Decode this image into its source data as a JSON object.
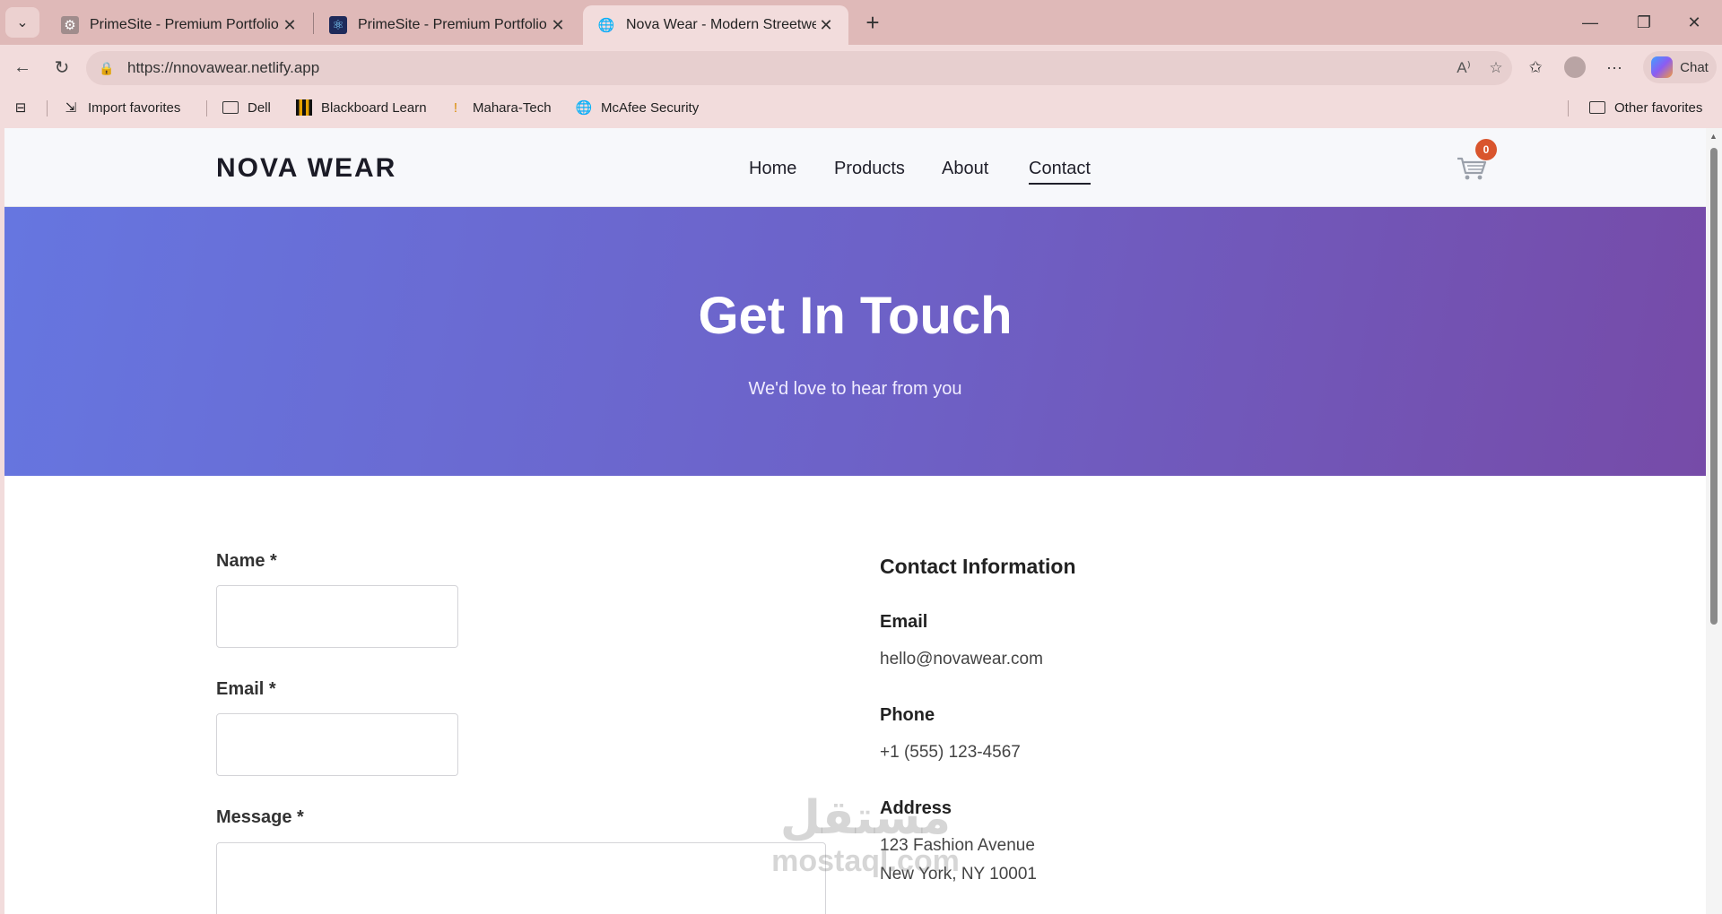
{
  "browser": {
    "tabs": [
      {
        "title": "PrimeSite - Premium Portfolio",
        "icon": "gear-icon"
      },
      {
        "title": "PrimeSite - Premium Portfolio",
        "icon": "react-icon"
      },
      {
        "title": "Nova Wear - Modern Streetwear F",
        "icon": "globe-icon",
        "active": true
      }
    ],
    "url": "https://nnovawear.netlify.app",
    "chat_label": "Chat",
    "bookmarks": [
      {
        "label": "Import favorites",
        "icon": "import-icon"
      },
      {
        "label": "Dell",
        "icon": "folder-icon"
      },
      {
        "label": "Blackboard Learn",
        "icon": "blackboard-icon"
      },
      {
        "label": "Mahara-Tech",
        "icon": "torch-icon"
      },
      {
        "label": "McAfee Security",
        "icon": "globe-icon"
      }
    ],
    "other_favorites": "Other favorites"
  },
  "site": {
    "logo": "NOVA WEAR",
    "nav": [
      {
        "label": "Home"
      },
      {
        "label": "Products"
      },
      {
        "label": "About"
      },
      {
        "label": "Contact",
        "active": true
      }
    ],
    "cart_count": "0",
    "hero": {
      "title": "Get In Touch",
      "subtitle": "We'd love to hear from you"
    },
    "form": {
      "name_label": "Name *",
      "email_label": "Email *",
      "message_label": "Message *"
    },
    "contact_info": {
      "title": "Contact Information",
      "email_label": "Email",
      "email_value": "hello@novawear.com",
      "phone_label": "Phone",
      "phone_value": "+1 (555) 123-4567",
      "address_label": "Address",
      "address_line1": "123 Fashion Avenue",
      "address_line2": "New York, NY 10001"
    }
  },
  "watermark": {
    "arabic": "مستقل",
    "latin": "mostaql.com"
  },
  "colors": {
    "tab_strip": "#dfb9b8",
    "toolbar": "#f2dcdc",
    "hero_start": "#6676e0",
    "hero_end": "#764ba8",
    "cart_badge": "#d9552d"
  }
}
